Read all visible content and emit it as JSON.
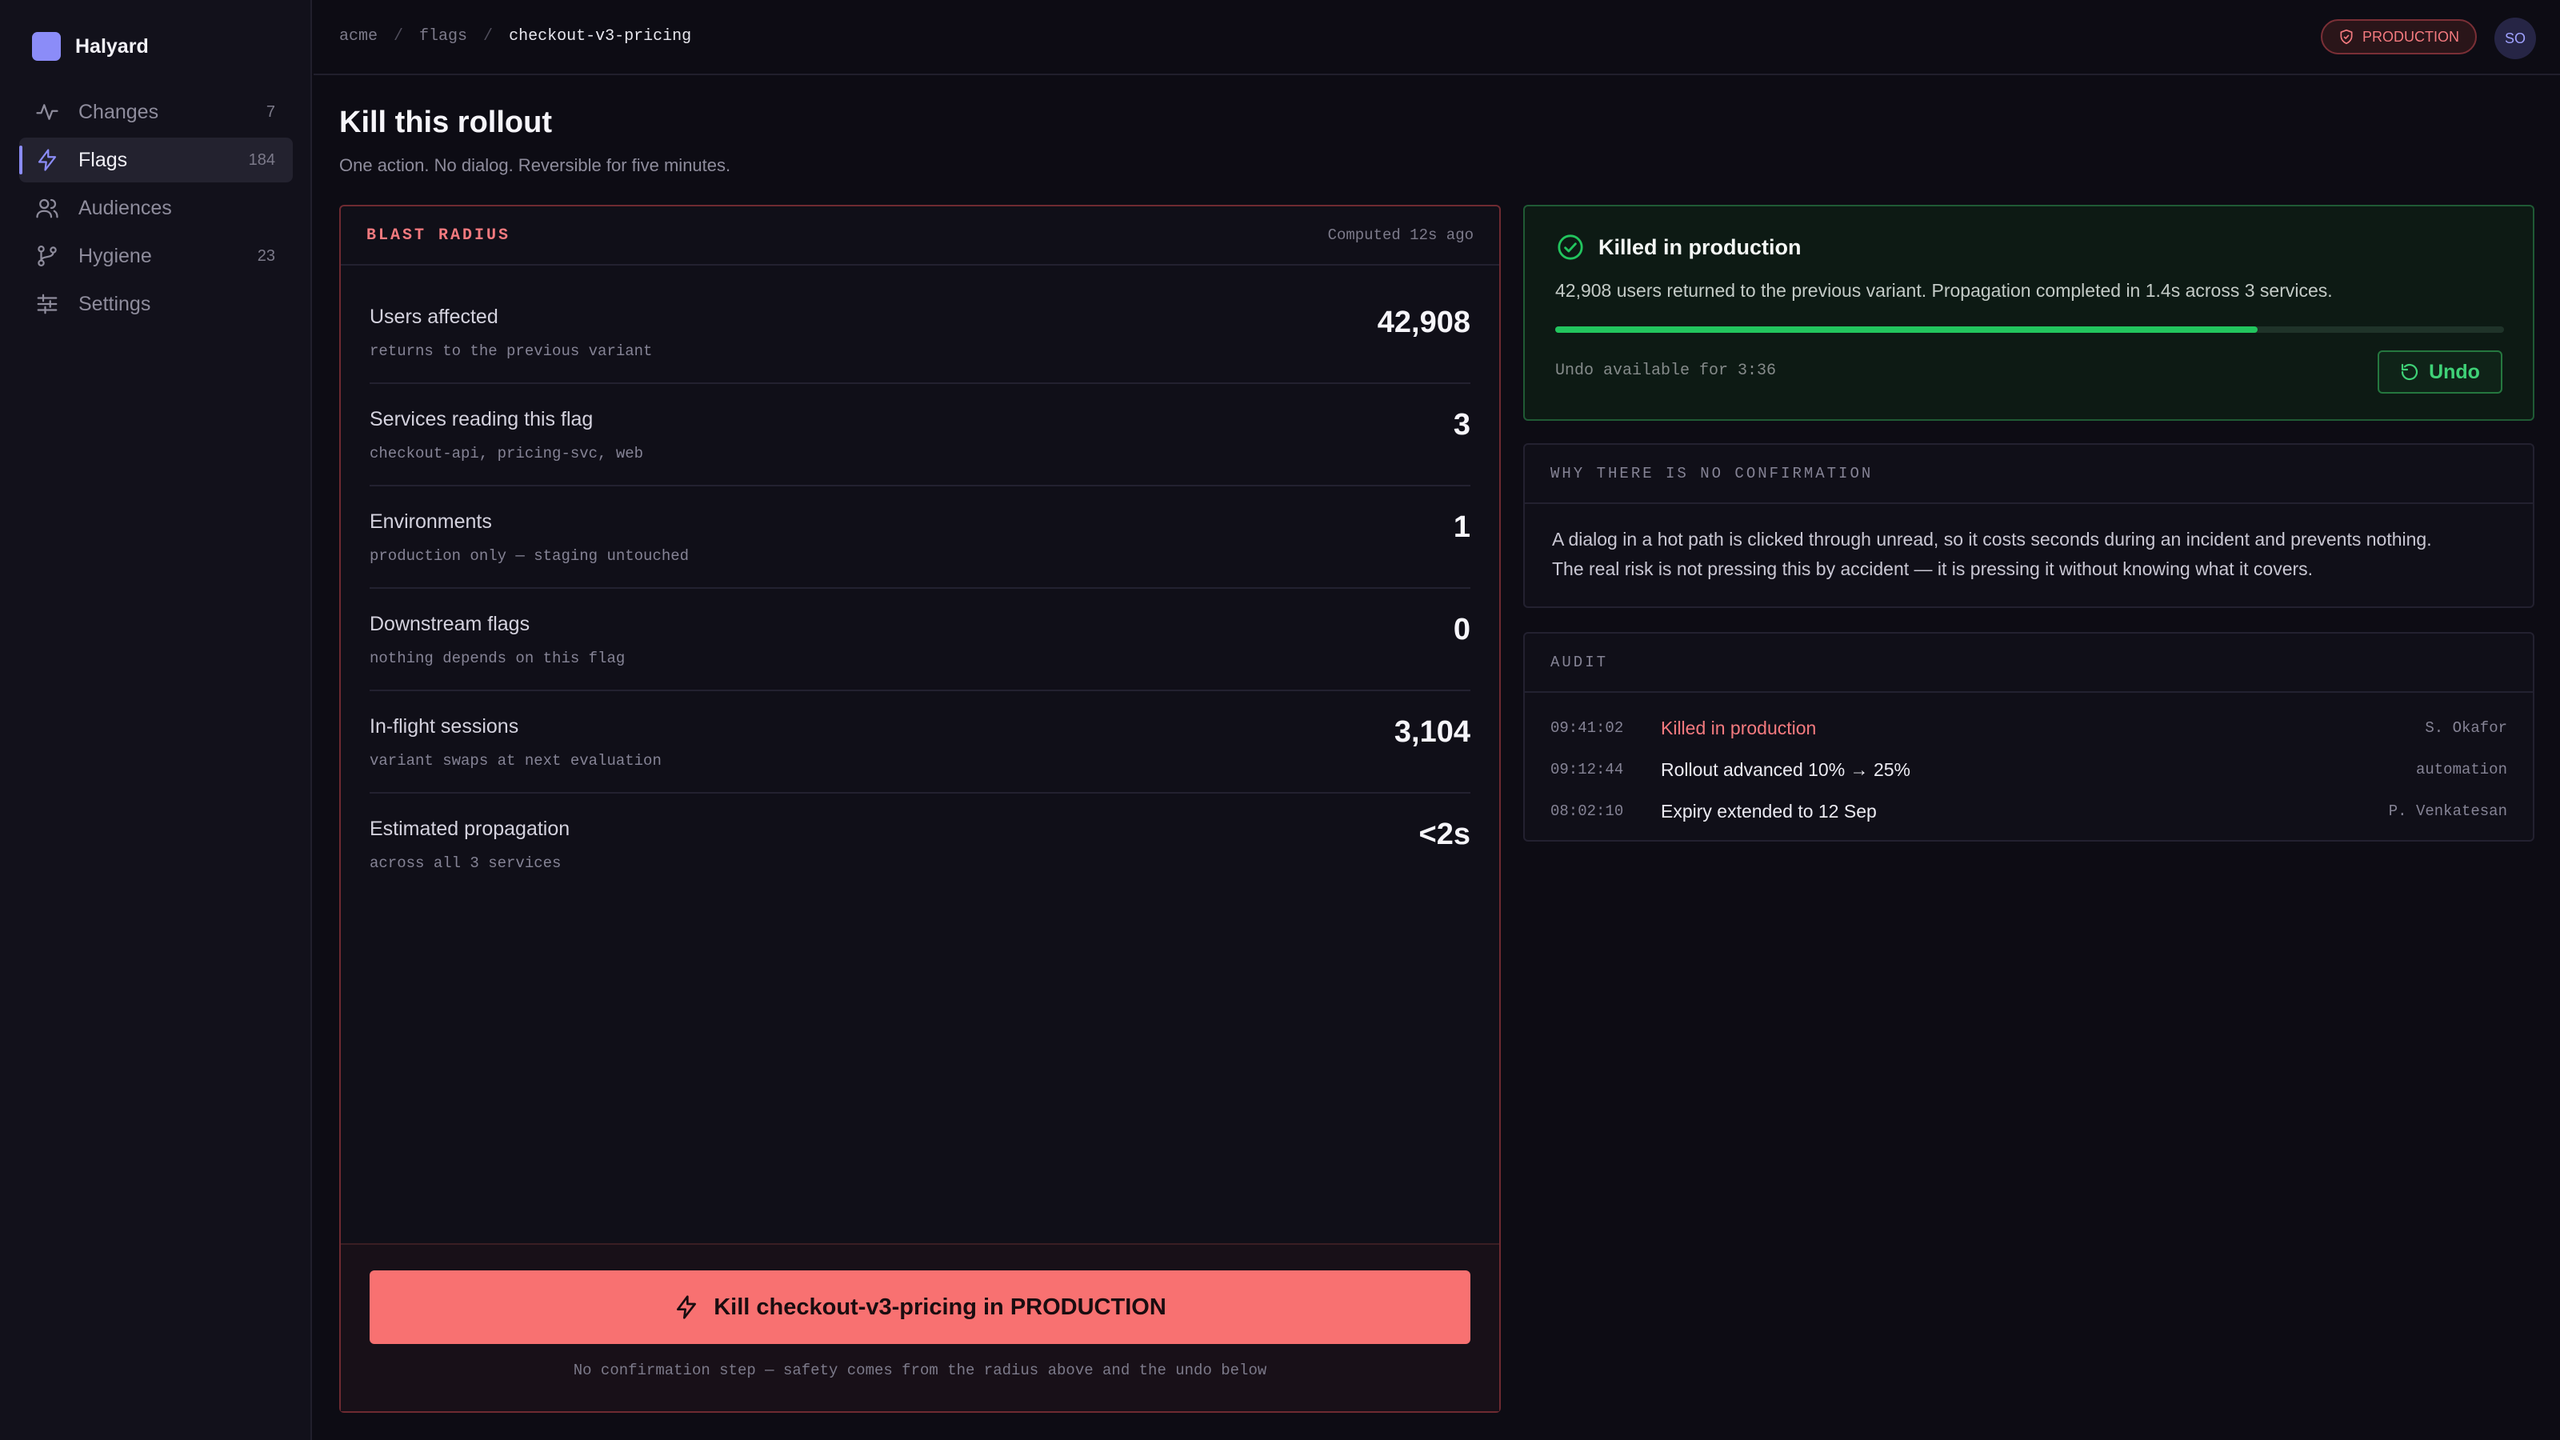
{
  "app": {
    "name": "Halyard",
    "brand_color": "#8b8cf8"
  },
  "sidebar": {
    "items": [
      {
        "label": "Changes",
        "count": "7",
        "icon": "activity-icon"
      },
      {
        "label": "Flags",
        "count": "184",
        "icon": "bolt-icon",
        "active": true
      },
      {
        "label": "Audiences",
        "count": "",
        "icon": "users-icon"
      },
      {
        "label": "Hygiene",
        "count": "23",
        "icon": "branch-icon"
      },
      {
        "label": "Settings",
        "count": "",
        "icon": "sliders-icon"
      }
    ]
  },
  "breadcrumb": {
    "org": "acme",
    "section": "flags",
    "current": "checkout-v3-pricing"
  },
  "header": {
    "environment": "PRODUCTION",
    "avatar_initials": "SO"
  },
  "page": {
    "title": "Kill this rollout",
    "subtitle": "One action. No dialog. Reversible for five minutes."
  },
  "blast_radius": {
    "title": "BLAST RADIUS",
    "computed": "Computed 12s ago",
    "metrics": [
      {
        "label": "Users affected",
        "sub": "returns to the previous variant",
        "value": "42,908"
      },
      {
        "label": "Services reading this flag",
        "sub": "checkout-api, pricing-svc, web",
        "value": "3"
      },
      {
        "label": "Environments",
        "sub": "production only — staging untouched",
        "value": "1"
      },
      {
        "label": "Downstream flags",
        "sub": "nothing depends on this flag",
        "value": "0"
      },
      {
        "label": "In-flight sessions",
        "sub": "variant swaps at next evaluation",
        "value": "3,104"
      },
      {
        "label": "Estimated propagation",
        "sub": "across all 3 services",
        "value": "<2s"
      }
    ],
    "kill_button": "Kill checkout-v3-pricing in PRODUCTION",
    "kill_note": "No confirmation step — safety comes from the radius above and the undo below",
    "danger_color": "#f87171"
  },
  "status": {
    "title": "Killed in production",
    "description": "42,908 users returned to the previous variant. Propagation completed in 1.4s across 3 services.",
    "progress": 0.74,
    "undo_text": "Undo available for 3:36",
    "undo_label": "Undo",
    "success_color": "#22c55e"
  },
  "why": {
    "title": "WHY THERE IS NO CONFIRMATION",
    "line1": "A dialog in a hot path is clicked through unread, so it costs seconds during an incident and prevents nothing.",
    "line2": "The real risk is not pressing this by accident — it is pressing it without knowing what it covers."
  },
  "audit": {
    "title": "AUDIT",
    "rows": [
      {
        "time": "09:41:02",
        "event": "Killed in production",
        "actor": "S. Okafor"
      },
      {
        "time": "09:12:44",
        "event": "Rollout advanced 10% → 25%",
        "actor": "automation"
      },
      {
        "time": "08:02:10",
        "event": "Expiry extended to 12 Sep",
        "actor": "P. Venkatesan"
      }
    ]
  }
}
